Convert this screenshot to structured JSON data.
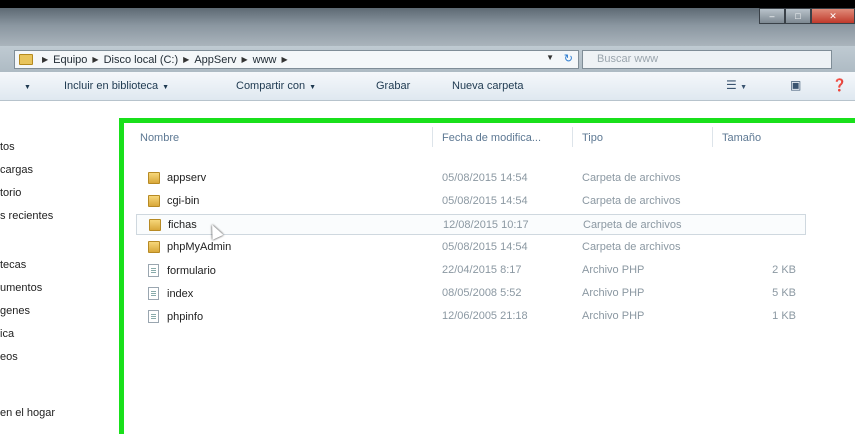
{
  "address_bar": {
    "crumbs": [
      "Equipo",
      "Disco local (C:)",
      "AppServ",
      "www"
    ],
    "search_placeholder": "Buscar www"
  },
  "toolbar": {
    "include_library": "Incluir en biblioteca",
    "share_with": "Compartir con",
    "burn": "Grabar",
    "new_folder": "Nueva carpeta"
  },
  "sidebar": {
    "items": [
      "tos",
      "cargas",
      "torio",
      "s recientes",
      "tecas",
      "umentos",
      "genes",
      "ica",
      "eos",
      "en el hogar"
    ]
  },
  "columns": {
    "name": "Nombre",
    "date": "Fecha de modifica...",
    "type": "Tipo",
    "size": "Tamaño"
  },
  "files": [
    {
      "name": "appserv",
      "date": "05/08/2015 14:54",
      "type": "Carpeta de archivos",
      "size": "",
      "icon": "folder-icon"
    },
    {
      "name": "cgi-bin",
      "date": "05/08/2015 14:54",
      "type": "Carpeta de archivos",
      "size": "",
      "icon": "folder-icon"
    },
    {
      "name": "fichas",
      "date": "12/08/2015 10:17",
      "type": "Carpeta de archivos",
      "size": "",
      "icon": "folder-icon"
    },
    {
      "name": "phpMyAdmin",
      "date": "05/08/2015 14:54",
      "type": "Carpeta de archivos",
      "size": "",
      "icon": "folder-icon"
    },
    {
      "name": "formulario",
      "date": "22/04/2015 8:17",
      "type": "Archivo PHP",
      "size": "2 KB",
      "icon": "php-file-icon"
    },
    {
      "name": "index",
      "date": "08/05/2008 5:52",
      "type": "Archivo PHP",
      "size": "5 KB",
      "icon": "php-file-icon"
    },
    {
      "name": "phpinfo",
      "date": "12/06/2005 21:18",
      "type": "Archivo PHP",
      "size": "1 KB",
      "icon": "php-file-icon"
    }
  ],
  "colors": {
    "highlight": "#19e01b",
    "folder": "#e8c45c"
  }
}
